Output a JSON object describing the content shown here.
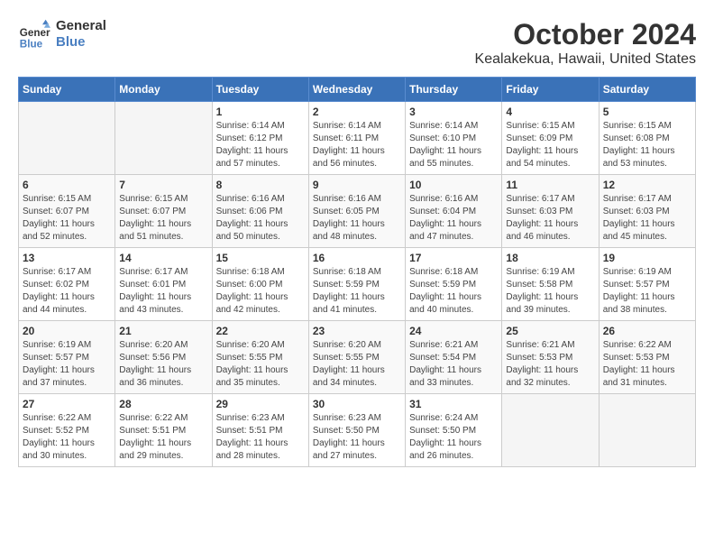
{
  "logo": {
    "text_general": "General",
    "text_blue": "Blue"
  },
  "title": "October 2024",
  "subtitle": "Kealakekua, Hawaii, United States",
  "header_days": [
    "Sunday",
    "Monday",
    "Tuesday",
    "Wednesday",
    "Thursday",
    "Friday",
    "Saturday"
  ],
  "weeks": [
    [
      {
        "day": "",
        "info": ""
      },
      {
        "day": "",
        "info": ""
      },
      {
        "day": "1",
        "info": "Sunrise: 6:14 AM\nSunset: 6:12 PM\nDaylight: 11 hours and 57 minutes."
      },
      {
        "day": "2",
        "info": "Sunrise: 6:14 AM\nSunset: 6:11 PM\nDaylight: 11 hours and 56 minutes."
      },
      {
        "day": "3",
        "info": "Sunrise: 6:14 AM\nSunset: 6:10 PM\nDaylight: 11 hours and 55 minutes."
      },
      {
        "day": "4",
        "info": "Sunrise: 6:15 AM\nSunset: 6:09 PM\nDaylight: 11 hours and 54 minutes."
      },
      {
        "day": "5",
        "info": "Sunrise: 6:15 AM\nSunset: 6:08 PM\nDaylight: 11 hours and 53 minutes."
      }
    ],
    [
      {
        "day": "6",
        "info": "Sunrise: 6:15 AM\nSunset: 6:07 PM\nDaylight: 11 hours and 52 minutes."
      },
      {
        "day": "7",
        "info": "Sunrise: 6:15 AM\nSunset: 6:07 PM\nDaylight: 11 hours and 51 minutes."
      },
      {
        "day": "8",
        "info": "Sunrise: 6:16 AM\nSunset: 6:06 PM\nDaylight: 11 hours and 50 minutes."
      },
      {
        "day": "9",
        "info": "Sunrise: 6:16 AM\nSunset: 6:05 PM\nDaylight: 11 hours and 48 minutes."
      },
      {
        "day": "10",
        "info": "Sunrise: 6:16 AM\nSunset: 6:04 PM\nDaylight: 11 hours and 47 minutes."
      },
      {
        "day": "11",
        "info": "Sunrise: 6:17 AM\nSunset: 6:03 PM\nDaylight: 11 hours and 46 minutes."
      },
      {
        "day": "12",
        "info": "Sunrise: 6:17 AM\nSunset: 6:03 PM\nDaylight: 11 hours and 45 minutes."
      }
    ],
    [
      {
        "day": "13",
        "info": "Sunrise: 6:17 AM\nSunset: 6:02 PM\nDaylight: 11 hours and 44 minutes."
      },
      {
        "day": "14",
        "info": "Sunrise: 6:17 AM\nSunset: 6:01 PM\nDaylight: 11 hours and 43 minutes."
      },
      {
        "day": "15",
        "info": "Sunrise: 6:18 AM\nSunset: 6:00 PM\nDaylight: 11 hours and 42 minutes."
      },
      {
        "day": "16",
        "info": "Sunrise: 6:18 AM\nSunset: 5:59 PM\nDaylight: 11 hours and 41 minutes."
      },
      {
        "day": "17",
        "info": "Sunrise: 6:18 AM\nSunset: 5:59 PM\nDaylight: 11 hours and 40 minutes."
      },
      {
        "day": "18",
        "info": "Sunrise: 6:19 AM\nSunset: 5:58 PM\nDaylight: 11 hours and 39 minutes."
      },
      {
        "day": "19",
        "info": "Sunrise: 6:19 AM\nSunset: 5:57 PM\nDaylight: 11 hours and 38 minutes."
      }
    ],
    [
      {
        "day": "20",
        "info": "Sunrise: 6:19 AM\nSunset: 5:57 PM\nDaylight: 11 hours and 37 minutes."
      },
      {
        "day": "21",
        "info": "Sunrise: 6:20 AM\nSunset: 5:56 PM\nDaylight: 11 hours and 36 minutes."
      },
      {
        "day": "22",
        "info": "Sunrise: 6:20 AM\nSunset: 5:55 PM\nDaylight: 11 hours and 35 minutes."
      },
      {
        "day": "23",
        "info": "Sunrise: 6:20 AM\nSunset: 5:55 PM\nDaylight: 11 hours and 34 minutes."
      },
      {
        "day": "24",
        "info": "Sunrise: 6:21 AM\nSunset: 5:54 PM\nDaylight: 11 hours and 33 minutes."
      },
      {
        "day": "25",
        "info": "Sunrise: 6:21 AM\nSunset: 5:53 PM\nDaylight: 11 hours and 32 minutes."
      },
      {
        "day": "26",
        "info": "Sunrise: 6:22 AM\nSunset: 5:53 PM\nDaylight: 11 hours and 31 minutes."
      }
    ],
    [
      {
        "day": "27",
        "info": "Sunrise: 6:22 AM\nSunset: 5:52 PM\nDaylight: 11 hours and 30 minutes."
      },
      {
        "day": "28",
        "info": "Sunrise: 6:22 AM\nSunset: 5:51 PM\nDaylight: 11 hours and 29 minutes."
      },
      {
        "day": "29",
        "info": "Sunrise: 6:23 AM\nSunset: 5:51 PM\nDaylight: 11 hours and 28 minutes."
      },
      {
        "day": "30",
        "info": "Sunrise: 6:23 AM\nSunset: 5:50 PM\nDaylight: 11 hours and 27 minutes."
      },
      {
        "day": "31",
        "info": "Sunrise: 6:24 AM\nSunset: 5:50 PM\nDaylight: 11 hours and 26 minutes."
      },
      {
        "day": "",
        "info": ""
      },
      {
        "day": "",
        "info": ""
      }
    ]
  ]
}
